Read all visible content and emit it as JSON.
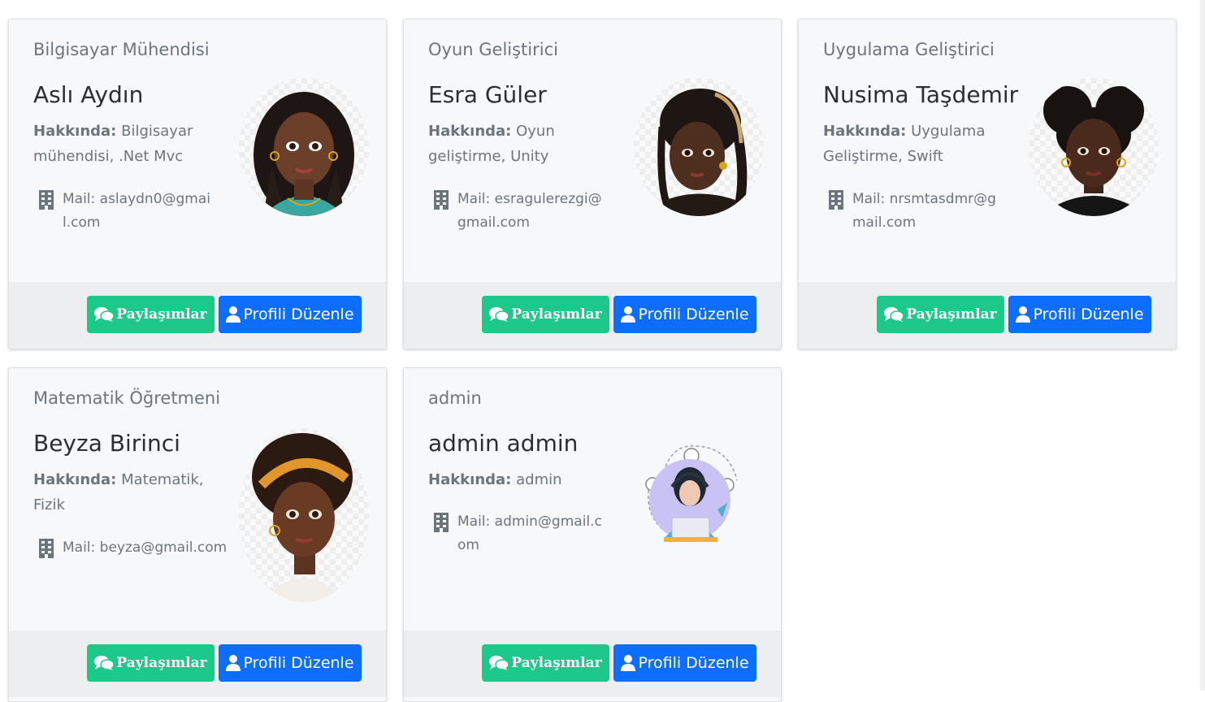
{
  "ui": {
    "about_label": "Hakkında:",
    "posts_button": "Paylaşımlar",
    "edit_button": "Profili Düzenle"
  },
  "colors": {
    "posts_button": "#1cc88a",
    "edit_button": "#0d6efd",
    "card_bg": "#f7f8fa",
    "footer_bg": "#eceef0"
  },
  "icons": {
    "mail": "building-icon",
    "posts": "comments-icon",
    "edit": "user-icon"
  },
  "cards": [
    {
      "occupation": "Bilgisayar Mühendisi",
      "name": "Aslı Aydın",
      "about": "Bilgisayar mühendisi, .Net Mvc",
      "mail": "Mail: aslaydn0@gmail.com",
      "avatar": "girl-braids-avatar"
    },
    {
      "occupation": "Oyun Geliştirici",
      "name": "Esra Güler",
      "about": "Oyun geliştirme, Unity",
      "mail": "Mail: esragulerezgi@gmail.com",
      "avatar": "girl-locs-avatar"
    },
    {
      "occupation": "Uygulama Geliştirici",
      "name": "Nusima Taşdemir",
      "about": "Uygulama Geliştirme, Swift",
      "mail": "Mail: nrsmtasdmr@gmail.com",
      "avatar": "girl-puffs-avatar"
    },
    {
      "occupation": "Matematik Öğretmeni",
      "name": "Beyza Birinci",
      "about": "Matematik, Fizik",
      "mail": "Mail: beyza@gmail.com",
      "avatar": "girl-headband-avatar"
    },
    {
      "occupation": "admin",
      "name": "admin admin",
      "about": "admin",
      "mail": "Mail: admin@gmail.com",
      "avatar": "support-agent-avatar"
    }
  ]
}
